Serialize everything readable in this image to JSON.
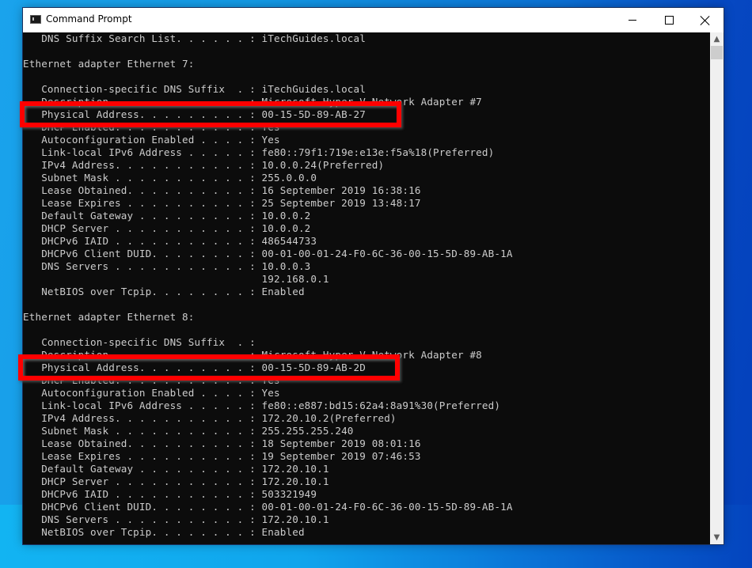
{
  "window": {
    "title": "Command Prompt",
    "icon": "cmd-icon",
    "controls": {
      "minimize": "minimize-icon",
      "maximize": "maximize-icon",
      "close": "close-icon"
    }
  },
  "console": {
    "lines": [
      "   DNS Suffix Search List. . . . . . : iTechGuides.local",
      "",
      "Ethernet adapter Ethernet 7:",
      "",
      "   Connection-specific DNS Suffix  . : iTechGuides.local",
      "   Description . . . . . . . . . . . : Microsoft Hyper-V Network Adapter #7",
      "   Physical Address. . . . . . . . . : 00-15-5D-89-AB-27",
      "   DHCP Enabled. . . . . . . . . . . : Yes",
      "   Autoconfiguration Enabled . . . . : Yes",
      "   Link-local IPv6 Address . . . . . : fe80::79f1:719e:e13e:f5a%18(Preferred)",
      "   IPv4 Address. . . . . . . . . . . : 10.0.0.24(Preferred)",
      "   Subnet Mask . . . . . . . . . . . : 255.0.0.0",
      "   Lease Obtained. . . . . . . . . . : 16 September 2019 16:38:16",
      "   Lease Expires . . . . . . . . . . : 25 September 2019 13:48:17",
      "   Default Gateway . . . . . . . . . : 10.0.0.2",
      "   DHCP Server . . . . . . . . . . . : 10.0.0.2",
      "   DHCPv6 IAID . . . . . . . . . . . : 486544733",
      "   DHCPv6 Client DUID. . . . . . . . : 00-01-00-01-24-F0-6C-36-00-15-5D-89-AB-1A",
      "   DNS Servers . . . . . . . . . . . : 10.0.0.3",
      "                                       192.168.0.1",
      "   NetBIOS over Tcpip. . . . . . . . : Enabled",
      "",
      "Ethernet adapter Ethernet 8:",
      "",
      "   Connection-specific DNS Suffix  . :",
      "   Description . . . . . . . . . . . : Microsoft Hyper-V Network Adapter #8",
      "   Physical Address. . . . . . . . . : 00-15-5D-89-AB-2D",
      "   DHCP Enabled. . . . . . . . . . . : Yes",
      "   Autoconfiguration Enabled . . . . : Yes",
      "   Link-local IPv6 Address . . . . . : fe80::e887:bd15:62a4:8a91%30(Preferred)",
      "   IPv4 Address. . . . . . . . . . . : 172.20.10.2(Preferred)",
      "   Subnet Mask . . . . . . . . . . . : 255.255.255.240",
      "   Lease Obtained. . . . . . . . . . : 18 September 2019 08:01:16",
      "   Lease Expires . . . . . . . . . . : 19 September 2019 07:46:53",
      "   Default Gateway . . . . . . . . . : 172.20.10.1",
      "   DHCP Server . . . . . . . . . . . : 172.20.10.1",
      "   DHCPv6 IAID . . . . . . . . . . . : 503321949",
      "   DHCPv6 Client DUID. . . . . . . . : 00-01-00-01-24-F0-6C-36-00-15-5D-89-AB-1A",
      "   DNS Servers . . . . . . . . . . . : 172.20.10.1",
      "   NetBIOS over Tcpip. . . . . . . . : Enabled"
    ],
    "highlighted_lines": [
      6,
      26
    ]
  },
  "scrollbar": {
    "up_icon": "scroll-up-icon",
    "down_icon": "scroll-down-icon"
  },
  "colors": {
    "console_bg": "#0c0c0c",
    "console_text": "#cccccc",
    "highlight": "#ff0000"
  }
}
